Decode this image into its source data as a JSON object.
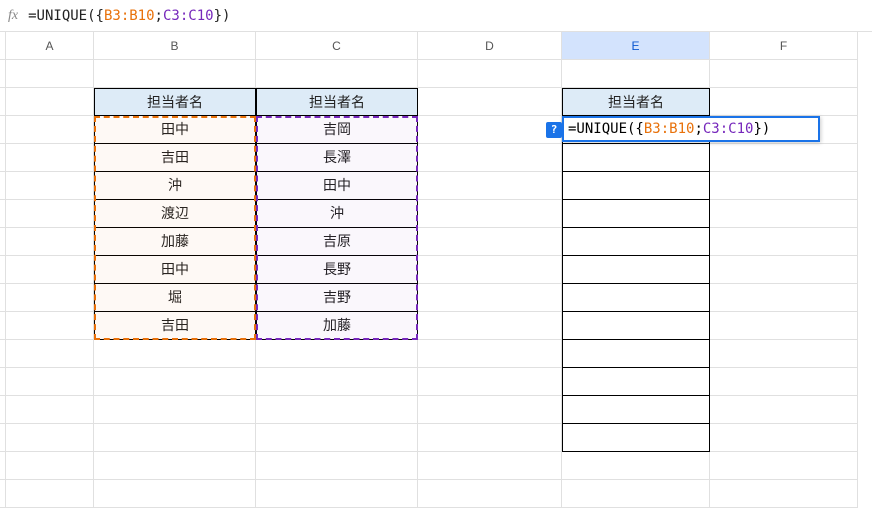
{
  "formula_bar": {
    "fx_label": "fx",
    "prefix": "=UNIQUE({",
    "range1": "B3:B10",
    "sep": ";",
    "range2": "C3:C10",
    "suffix": "})"
  },
  "columns": {
    "A": "A",
    "B": "B",
    "C": "C",
    "D": "D",
    "E": "E",
    "F": "F"
  },
  "headers": {
    "b": "担当者名",
    "c": "担当者名",
    "e": "担当者名"
  },
  "table_b": [
    "田中",
    "吉田",
    "沖",
    "渡辺",
    "加藤",
    "田中",
    "堀",
    "吉田"
  ],
  "table_c": [
    "吉岡",
    "長澤",
    "田中",
    "沖",
    "吉原",
    "長野",
    "吉野",
    "加藤"
  ],
  "editing": {
    "help": "?",
    "prefix": "=UNIQUE({",
    "range1": "B3:B10",
    "sep": ";",
    "range2": "C3:C10",
    "suffix": "})"
  },
  "chart_data": {
    "type": "table",
    "tables": [
      {
        "header": "担当者名",
        "column": "B",
        "rows": [
          "田中",
          "吉田",
          "沖",
          "渡辺",
          "加藤",
          "田中",
          "堀",
          "吉田"
        ]
      },
      {
        "header": "担当者名",
        "column": "C",
        "rows": [
          "吉岡",
          "長澤",
          "田中",
          "沖",
          "吉原",
          "長野",
          "吉野",
          "加藤"
        ]
      }
    ],
    "formula_cell": "E3",
    "formula": "=UNIQUE({B3:B10;C3:C10})"
  }
}
